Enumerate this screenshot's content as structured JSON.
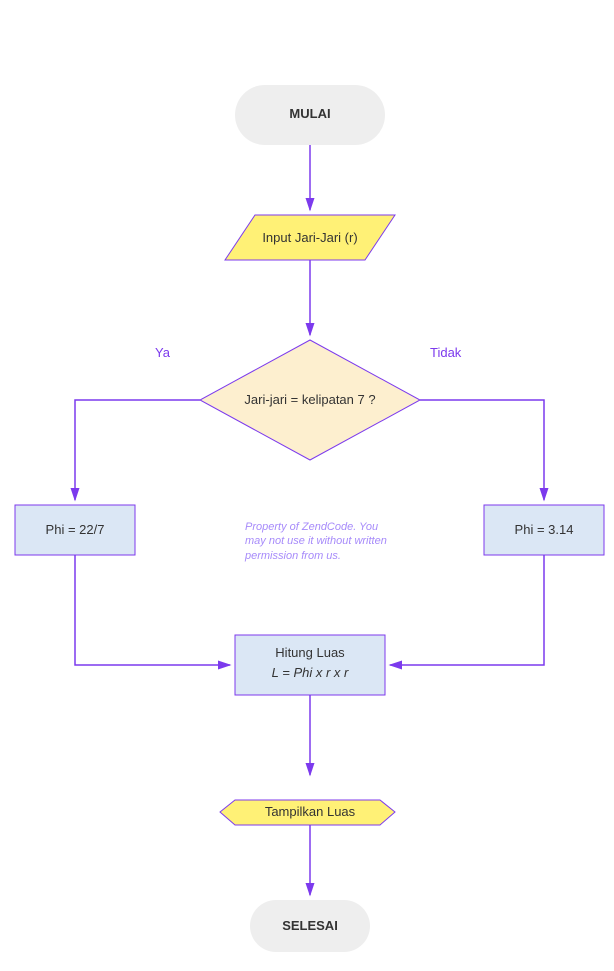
{
  "flowchart": {
    "start": {
      "label": "MULAI"
    },
    "input": {
      "label": "Input Jari-Jari (r)"
    },
    "decision": {
      "label": "Jari-jari = kelipatan 7 ?"
    },
    "decision_yes": "Ya",
    "decision_no": "Tidak",
    "phi_left": {
      "label": "Phi = 22/7"
    },
    "phi_right": {
      "label": "Phi = 3.14"
    },
    "compute": {
      "title": "Hitung Luas",
      "formula": "L = Phi x r x r"
    },
    "output": {
      "label": "Tampilkan Luas"
    },
    "end": {
      "label": "SELESAI"
    }
  },
  "watermark": "Property of ZendCode. You may not use it without written permission from us.",
  "colors": {
    "line": "#7c3aed",
    "terminal_fill": "#eeeeee",
    "io_fill": "#fff176",
    "decision_fill": "#fdefcf",
    "process_fill": "#dbe7f5"
  }
}
